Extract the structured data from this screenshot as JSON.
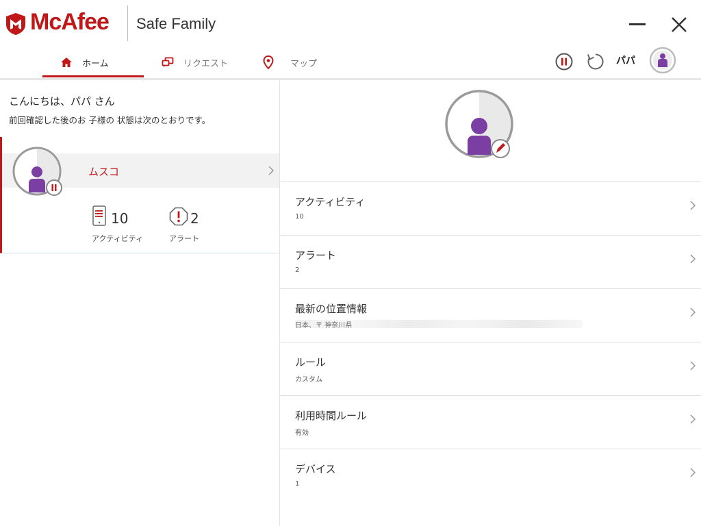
{
  "app": {
    "brand": "McAfee",
    "product": "Safe Family"
  },
  "nav": {
    "tabs": [
      {
        "label": "ホーム",
        "icon": "home-icon",
        "active": true
      },
      {
        "label": "リクエスト",
        "icon": "request-icon",
        "active": false
      },
      {
        "label": "マップ",
        "icon": "map-pin-icon",
        "active": false
      }
    ],
    "user_name": "パパ"
  },
  "home": {
    "greeting": "こんにちは、パパ さん",
    "subtitle": "前回確認した後のお 子様の 状態は次のとおりです。",
    "child": {
      "name": "ムスコ",
      "activity_count": "10",
      "activity_label": "アクティビティ",
      "alert_count": "2",
      "alert_label": "アラート"
    }
  },
  "details": {
    "items": [
      {
        "title": "アクティビティ",
        "sub": "10"
      },
      {
        "title": "アラート",
        "sub": "2"
      },
      {
        "title": "最新の位置情報",
        "sub": "日本、〒 神奈川県"
      },
      {
        "title": "ルール",
        "sub": "カスタム"
      },
      {
        "title": "利用時間ルール",
        "sub": "有効"
      },
      {
        "title": "デバイス",
        "sub": "1"
      }
    ]
  },
  "colors": {
    "accent": "#c01818",
    "avatar": "#7b3fa4"
  }
}
